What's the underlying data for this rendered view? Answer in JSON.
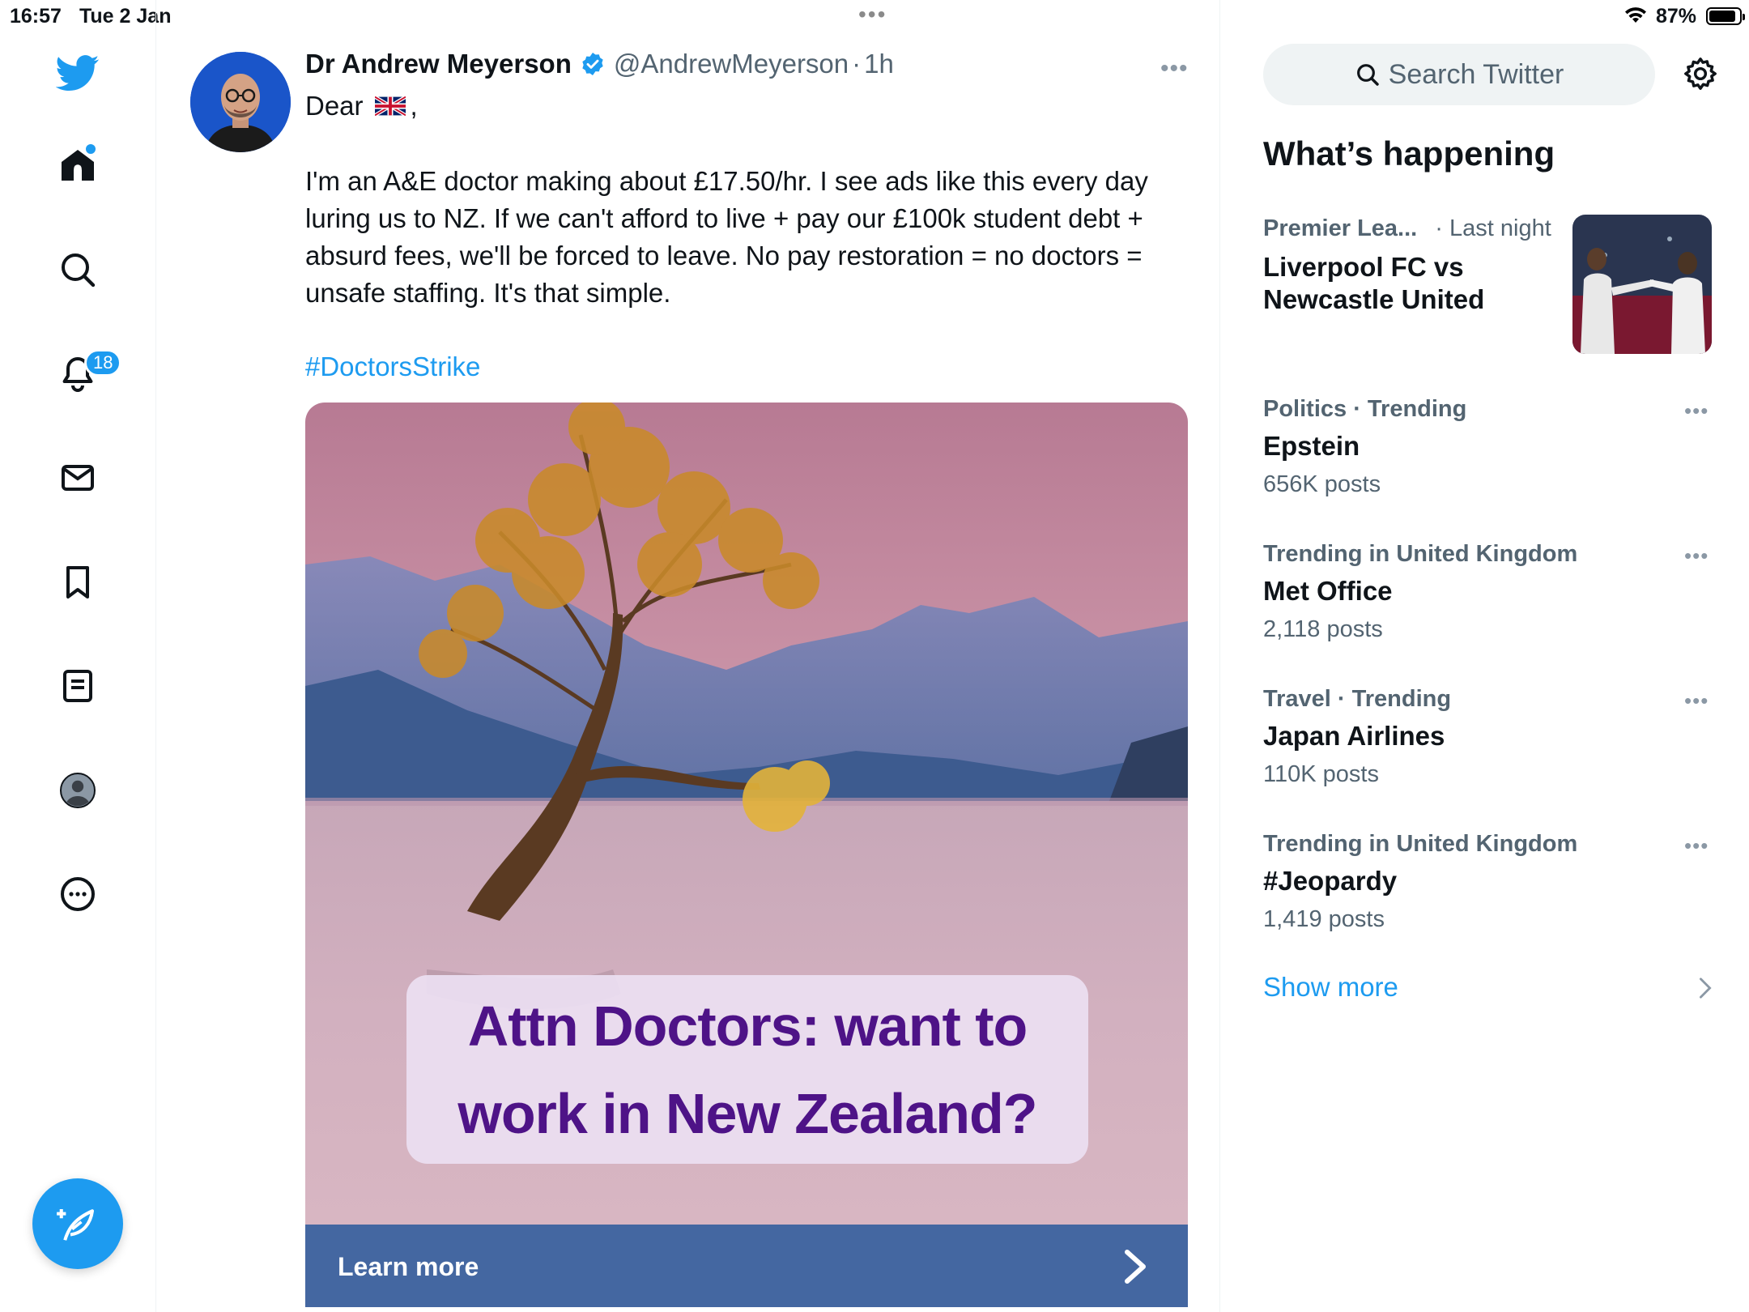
{
  "status_bar": {
    "time": "16:57",
    "date": "Tue 2 Jan",
    "battery_percent": "87%",
    "battery_level": 0.87
  },
  "nav": {
    "notifications_badge": "18",
    "icons": [
      "twitter-logo-icon",
      "home-icon",
      "search-icon",
      "notifications-icon",
      "messages-icon",
      "bookmarks-icon",
      "lists-icon",
      "profile-icon",
      "more-icon"
    ]
  },
  "tweet": {
    "author_name": "Dr Andrew Meyerson",
    "handle": "@AndrewMeyerson",
    "separator": "·",
    "time": "1h",
    "greeting": "Dear",
    "greeting_suffix": ",",
    "body": "I'm an A&E doctor making about £17.50/hr. I see ads like this every day luring us to NZ. If we can't afford to live + pay our £100k student debt + absurd fees, we'll be forced to leave. No pay restoration = no doctors = unsafe staffing. It's that simple.",
    "hashtag": "#DoctorsStrike",
    "ad_headline": "Attn Doctors: want to work in New Zealand?",
    "cta_label": "Learn more"
  },
  "sidebar": {
    "search_placeholder": "Search Twitter",
    "section_title": "What’s happening",
    "trends": [
      {
        "category": "Premier Lea...",
        "context": "· Last night",
        "topic": "Liverpool FC vs Newcastle United",
        "count": ""
      },
      {
        "category": "Politics · Trending",
        "context": "",
        "topic": "Epstein",
        "count": "656K posts"
      },
      {
        "category": "Trending in United Kingdom",
        "context": "",
        "topic": "Met Office",
        "count": "2,118 posts"
      },
      {
        "category": "Travel · Trending",
        "context": "",
        "topic": "Japan Airlines",
        "count": "110K posts"
      },
      {
        "category": "Trending in United Kingdom",
        "context": "",
        "topic": "#Jeopardy",
        "count": "1,419 posts"
      }
    ],
    "show_more": "Show more"
  },
  "colors": {
    "accent": "#1d9bf0",
    "secondary_text": "#536471",
    "ad_purple": "#4e1387",
    "cta_bar": "#4467a1"
  }
}
